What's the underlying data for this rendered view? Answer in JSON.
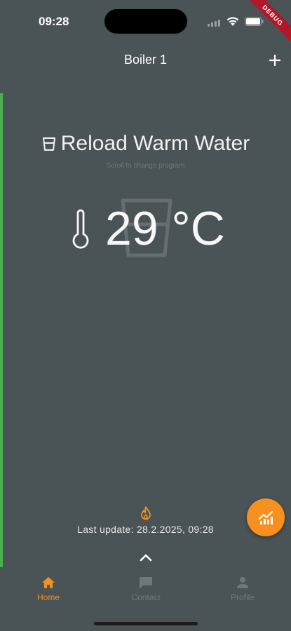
{
  "status_bar": {
    "time": "09:28",
    "debug_label": "DEBUG"
  },
  "app_bar": {
    "title": "Boiler 1",
    "add_icon": "plus-icon"
  },
  "program": {
    "name": "Reload Warm Water",
    "hint": "Scroll to change program",
    "icon": "glass-icon"
  },
  "temperature": {
    "value": "29 °C",
    "icon": "thermometer-icon"
  },
  "info": {
    "flame_icon": "flame-icon",
    "last_update": "Last update: 28.2.2025, 09:28"
  },
  "fab": {
    "icon": "chart-icon"
  },
  "nav": {
    "items": [
      {
        "label": "Home",
        "icon": "home-icon",
        "active": true
      },
      {
        "label": "Contact",
        "icon": "chat-icon",
        "active": false
      },
      {
        "label": "Profile",
        "icon": "person-icon",
        "active": false
      }
    ]
  },
  "colors": {
    "background": "#4a5355",
    "accent": "#f7901e",
    "indicator": "#4caf50",
    "inactive": "#6e777a",
    "debug": "#b0182a"
  }
}
